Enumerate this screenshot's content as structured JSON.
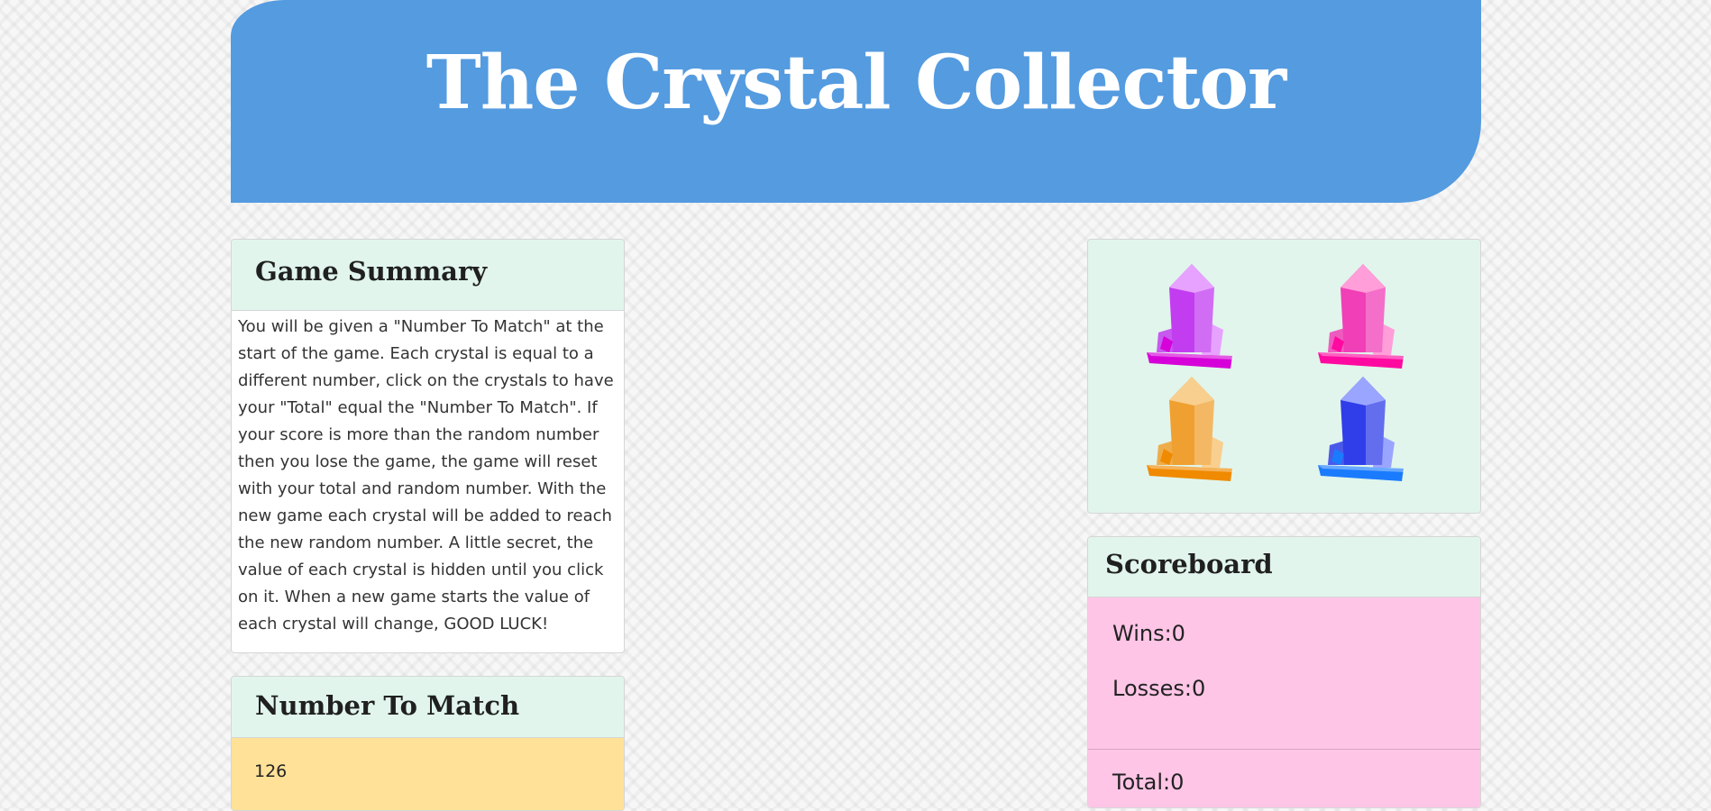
{
  "header": {
    "title": "The Crystal Collector"
  },
  "summary": {
    "heading": "Game Summary",
    "text": "You will be given a \"Number To Match\" at the start of the game. Each crystal is equal to a different number, click on the crystals to have your \"Total\" equal the \"Number To Match\". If your score is more than the random number then you lose the game, the game will reset with your total and random number. With the new game each crystal will be added to reach the new random number. A little secret, the value of each crystal is hidden until you click on it. When a new game starts the value of each crystal will change, GOOD LUCK!"
  },
  "match": {
    "heading": "Number To Match",
    "value": "126"
  },
  "crystals": [
    {
      "name": "purple",
      "color": "#c23df0",
      "light": "#e7a2ff",
      "base": "#d600d8"
    },
    {
      "name": "pink",
      "color": "#f03fb7",
      "light": "#ff9ed9",
      "base": "#ff0aa0"
    },
    {
      "name": "orange",
      "color": "#f0a030",
      "light": "#f8cf8e",
      "base": "#f08a00"
    },
    {
      "name": "blue",
      "color": "#2f3ee8",
      "light": "#9aa5ff",
      "base": "#1a7bff"
    }
  ],
  "scoreboard": {
    "heading": "Scoreboard",
    "wins": "Wins:0",
    "losses": "Losses:0",
    "total": "Total:0"
  }
}
